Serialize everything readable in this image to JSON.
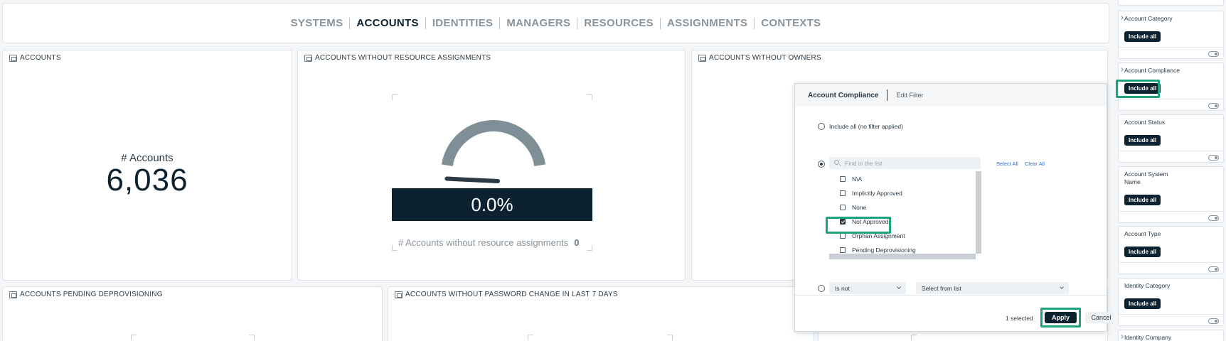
{
  "nav": {
    "tabs": [
      "SYSTEMS",
      "ACCOUNTS",
      "IDENTITIES",
      "MANAGERS",
      "RESOURCES",
      "ASSIGNMENTS",
      "CONTEXTS"
    ],
    "active": "ACCOUNTS"
  },
  "cards": {
    "accounts": {
      "title": "ACCOUNTS",
      "kpi_label": "# Accounts",
      "kpi_value": "6,036"
    },
    "no_resource": {
      "title": "ACCOUNTS WITHOUT RESOURCE ASSIGNMENTS",
      "gauge_value": "0.0%",
      "gauge_fraction": 0.0,
      "footer_label": "# Accounts without resource assignments",
      "footer_value": "0"
    },
    "no_owner": {
      "title": "ACCOUNTS WITHOUT OWNERS"
    },
    "pending": {
      "title": "ACCOUNTS PENDING DEPROVISIONING"
    },
    "no_pw": {
      "title": "ACCOUNTS WITHOUT PASSWORD CHANGE IN LAST 7 DAYS"
    }
  },
  "modal": {
    "title": "Account Compliance",
    "subtitle": "Edit Filter",
    "option_all": "Include all (no filter applied)",
    "search_placeholder": "Find in the list",
    "select_all": "Select All",
    "clear_all": "Clear All",
    "items": [
      {
        "label": "N\\A",
        "checked": false
      },
      {
        "label": "Implicitly Approved",
        "checked": false
      },
      {
        "label": "None",
        "checked": false
      },
      {
        "label": "Not Approved",
        "checked": true
      },
      {
        "label": "Orphan Assignment",
        "checked": false
      },
      {
        "label": "Pending Deprovisioning",
        "checked": false
      }
    ],
    "operator": "Is not",
    "value_placeholder": "Select from list",
    "selected_count": "1 selected",
    "apply": "Apply",
    "cancel": "Cancel"
  },
  "sidebar": {
    "top_field": "",
    "include_label": "Include all",
    "filters": [
      {
        "title": "Account Category"
      },
      {
        "title": "Account Compliance"
      },
      {
        "title": "Account Status"
      },
      {
        "title": "Account System Name"
      },
      {
        "title": "Account Type"
      },
      {
        "title": "Identity Category"
      },
      {
        "title": "Identity Company"
      }
    ]
  },
  "colors": {
    "accent": "#0c2230",
    "highlight": "#1fa37c",
    "link": "#2f6fd6",
    "gauge_track": "#7f8f97"
  }
}
